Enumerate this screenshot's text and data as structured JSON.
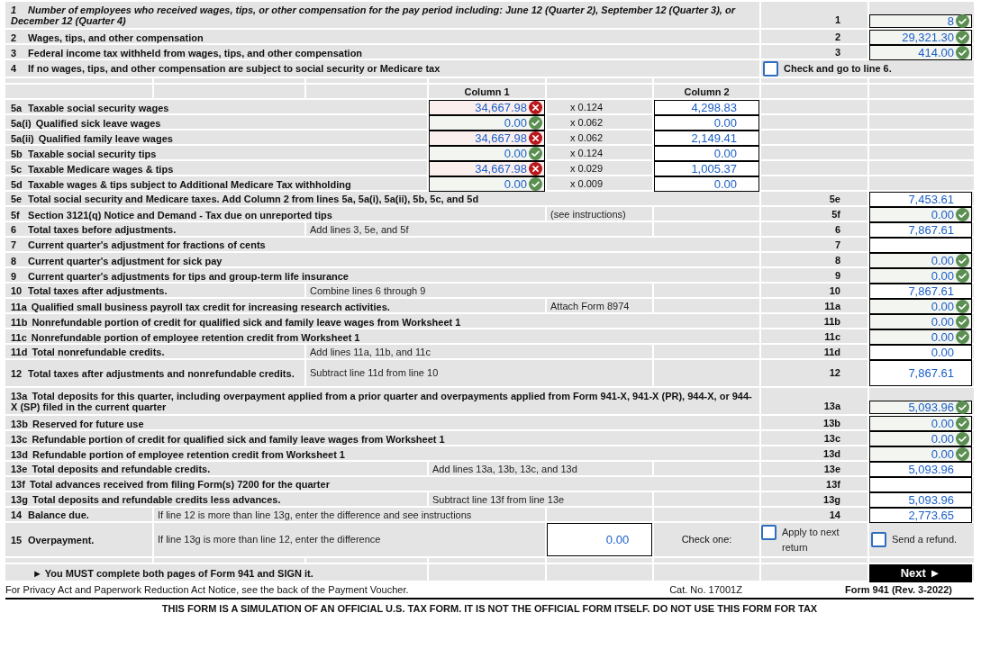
{
  "sections": [
    {
      "rows": [
        {
          "kind": "line",
          "number": "1",
          "label": "Number of employees who received wages, tips, or other compensation for the pay period including: June 12 (Quarter 2), September 12 (Quarter 3), or December 12 (Quarter 4)",
          "italic": true,
          "line_no": "1",
          "field": {
            "value": "8",
            "validated": true,
            "error": false
          }
        },
        {
          "kind": "line",
          "number": "2",
          "label": "Wages, tips, and other compensation",
          "italic": false,
          "line_no": "2",
          "field": {
            "value": "29,321.30",
            "validated": true,
            "error": false
          }
        },
        {
          "kind": "line",
          "number": "3",
          "label": "Federal income tax withheld from wages, tips, and other compensation",
          "italic": false,
          "line_no": "3",
          "field": {
            "value": "414.00",
            "validated": true,
            "error": false
          }
        },
        {
          "kind": "checkbox_line",
          "number": "4",
          "label": "If no wages, tips, and other compensation are subject to social security or Medicare tax",
          "italic": false,
          "checkbox": {
            "label": "Check and go to line 6.",
            "checked": false
          }
        },
        {
          "kind": "spacer"
        },
        {
          "kind": "column_header",
          "column_1": "Column 1",
          "column_2": "Column 2"
        },
        {
          "kind": "column_line",
          "number": "5a",
          "label": "Taxable social security wages",
          "italic": false,
          "column_1": {
            "value": "34,667.98",
            "validated": true,
            "error": true
          },
          "rate": "x 0.124",
          "column_2": {
            "value": "4,298.83",
            "validated": false,
            "error": false
          }
        },
        {
          "kind": "column_line",
          "number": "5a(i)",
          "label": "Qualified sick leave wages",
          "italic": false,
          "column_1": {
            "value": "0.00",
            "validated": true,
            "error": false
          },
          "rate": "x 0.062",
          "column_2": {
            "value": "0.00",
            "validated": false,
            "error": false
          }
        },
        {
          "kind": "column_line",
          "number": "5a(ii)",
          "label": "Qualified family leave wages",
          "italic": false,
          "column_1": {
            "value": "34,667.98",
            "validated": true,
            "error": true
          },
          "rate": "x 0.062",
          "column_2": {
            "value": "2,149.41",
            "validated": false,
            "error": false
          }
        },
        {
          "kind": "column_line",
          "number": "5b",
          "label": "Taxable social security tips",
          "italic": false,
          "column_1": {
            "value": "0.00",
            "validated": true,
            "error": false
          },
          "rate": "x 0.124",
          "column_2": {
            "value": "0.00",
            "validated": false,
            "error": false
          }
        },
        {
          "kind": "column_line",
          "number": "5c",
          "label": "Taxable Medicare wages & tips",
          "italic": false,
          "column_1": {
            "value": "34,667.98",
            "validated": true,
            "error": true
          },
          "rate": "x 0.029",
          "column_2": {
            "value": "1,005.37",
            "validated": false,
            "error": false
          }
        },
        {
          "kind": "column_line",
          "number": "5d",
          "label": "Taxable wages & tips subject to Additional Medicare Tax withholding",
          "italic": false,
          "column_1": {
            "value": "0.00",
            "validated": true,
            "error": false
          },
          "rate": "x 0.009",
          "column_2": {
            "value": "0.00",
            "validated": false,
            "error": false
          }
        }
      ]
    },
    {
      "rows": [
        {
          "kind": "line",
          "number": "5e",
          "label": "Total social security and Medicare taxes. Add Column 2 from lines 5a, 5a(i), 5a(ii), 5b, 5c, and 5d",
          "italic": false,
          "line_no": "5e",
          "field": {
            "value": "7,453.61",
            "validated": false,
            "error": false
          }
        },
        {
          "kind": "line",
          "number": "5f",
          "label": "Section 3121(q) Notice and Demand - Tax due on unreported tips",
          "italic": false,
          "reference": "(see instructions)",
          "line_no": "5f",
          "field": {
            "value": "0.00",
            "validated": true,
            "error": false
          }
        },
        {
          "kind": "line",
          "number": "6",
          "label": "Total taxes before adjustments.",
          "italic": false,
          "note": "Add lines 3, 5e, and 5f",
          "line_no": "6",
          "field": {
            "value": "7,867.61",
            "validated": false,
            "error": false
          }
        },
        {
          "kind": "line",
          "number": "7",
          "label": "Current quarter's adjustment for fractions of cents",
          "italic": false,
          "line_no": "7",
          "field": {
            "validated": false,
            "error": false
          }
        },
        {
          "kind": "line",
          "number": "8",
          "label": "Current quarter's adjustment for sick pay",
          "italic": false,
          "line_no": "8",
          "field": {
            "value": "0.00",
            "validated": true,
            "error": false
          }
        },
        {
          "kind": "line",
          "number": "9",
          "label": "Current quarter's adjustments for tips and group-term life insurance",
          "italic": false,
          "line_no": "9",
          "field": {
            "value": "0.00",
            "validated": true,
            "error": false
          }
        },
        {
          "kind": "line",
          "number": "10",
          "label": "Total taxes after adjustments.",
          "italic": false,
          "note": "Combine lines 6 through 9",
          "line_no": "10",
          "field": {
            "value": "7,867.61",
            "validated": false,
            "error": false
          }
        },
        {
          "kind": "line",
          "number": "11a",
          "label": "Qualified small business payroll tax credit for increasing research activities.",
          "italic": false,
          "reference": "Attach Form 8974",
          "line_no": "11a",
          "field": {
            "value": "0.00",
            "validated": true,
            "error": false
          }
        },
        {
          "kind": "line",
          "number": "11b",
          "label": "Nonrefundable portion of credit for qualified sick and family leave wages from Worksheet 1",
          "italic": false,
          "line_no": "11b",
          "field": {
            "value": "0.00",
            "validated": true,
            "error": false
          }
        },
        {
          "kind": "line",
          "number": "11c",
          "label": "Nonrefundable portion of employee retention credit from Worksheet 1",
          "italic": false,
          "line_no": "11c",
          "field": {
            "value": "0.00",
            "validated": true,
            "error": false
          }
        },
        {
          "kind": "line",
          "number": "11d",
          "label": "Total nonrefundable credits.",
          "italic": false,
          "note": "Add lines 11a, 11b, and 11c",
          "line_no": "11d",
          "field": {
            "value": "0.00",
            "validated": false,
            "error": false
          }
        },
        {
          "kind": "line",
          "number": "12",
          "label": "Total taxes after adjustments and nonrefundable credits.",
          "italic": false,
          "note": "Subtract line 11d from line 10",
          "line_no": "12",
          "field": {
            "value": "7,867.61",
            "validated": false,
            "error": false
          }
        }
      ]
    },
    {
      "rows": [
        {
          "kind": "line",
          "number": "13a",
          "label": "Total deposits for this quarter, including overpayment applied from a prior quarter and overpayments applied from Form 941-X, 941-X (PR), 944-X, or 944-X (SP) filed in the current quarter",
          "italic": false,
          "line_no": "13a",
          "field": {
            "value": "5,093.96",
            "validated": true,
            "error": false
          }
        },
        {
          "kind": "line",
          "number": "13b",
          "label": "Reserved for future use",
          "italic": false,
          "line_no": "13b",
          "field": {
            "value": "0.00",
            "validated": true,
            "error": false
          }
        },
        {
          "kind": "line",
          "number": "13c",
          "label": "Refundable portion of credit for qualified sick and family leave wages from Worksheet 1",
          "italic": false,
          "line_no": "13c",
          "field": {
            "value": "0.00",
            "validated": true,
            "error": false
          }
        },
        {
          "kind": "line",
          "number": "13d",
          "label": "Refundable portion of employee retention credit from Worksheet 1",
          "italic": false,
          "line_no": "13d",
          "field": {
            "value": "0.00",
            "validated": true,
            "error": false
          }
        },
        {
          "kind": "line",
          "number": "13e",
          "label": "Total deposits and refundable credits.",
          "italic": false,
          "note": "Add lines 13a, 13b, 13c, and 13d",
          "line_no": "13e",
          "field": {
            "value": "5,093.96",
            "validated": false,
            "error": false
          }
        },
        {
          "kind": "line",
          "number": "13f",
          "label": "Total advances received from filing Form(s) 7200 for the quarter",
          "italic": false,
          "line_no": "13f",
          "field": {
            "validated": false,
            "error": false
          }
        },
        {
          "kind": "line",
          "number": "13g",
          "label": "Total deposits and refundable credits less advances.",
          "italic": false,
          "note": "Subtract line 13f from line 13e",
          "line_no": "13g",
          "field": {
            "value": "5,093.96",
            "validated": false,
            "error": false
          }
        }
      ]
    },
    {
      "rows": [
        {
          "kind": "line",
          "number": "14",
          "label": "Balance due.",
          "italic": false,
          "note": "If line 12 is more than line 13g, enter the difference and see instructions",
          "line_no": "14",
          "field": {
            "value": "2,773.65",
            "validated": false,
            "error": false
          }
        },
        {
          "kind": "overpayment",
          "number": "15",
          "label": "Overpayment.",
          "italic": false,
          "note": "If line 13g is more than line 12, enter the difference",
          "field": {
            "value": "0.00",
            "validated": false,
            "error": false
          },
          "check_label": "Check one:",
          "options": [
            {
              "label": "Apply to next return",
              "checked": false
            },
            {
              "label": "Send a refund.",
              "checked": false
            }
          ]
        },
        {
          "kind": "spacer"
        },
        {
          "kind": "footer",
          "text": "► You MUST complete both pages of Form 941 and SIGN it.",
          "button": "Next ►"
        }
      ]
    }
  ],
  "notice": {
    "privacy": "For Privacy Act and Paperwork Reduction Act Notice, see the back of the Payment Voucher.",
    "catalog": "Cat. No. 17001Z",
    "form": "Form 941 (Rev. 3-2022)"
  },
  "disclaimer": "THIS FORM IS A SIMULATION OF AN OFFICIAL U.S. TAX FORM. IT IS NOT THE OFFICIAL FORM ITSELF. DO NOT USE THIS FORM FOR TAX"
}
